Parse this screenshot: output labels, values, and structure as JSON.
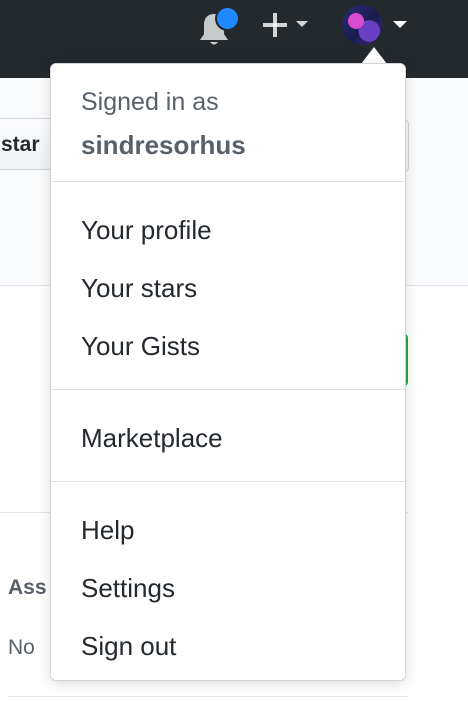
{
  "header": {
    "notifications": {
      "icon": "bell-icon",
      "has_unread": true,
      "indicator_color": "#2188ff"
    },
    "create_menu": {
      "icon": "plus-icon"
    },
    "user_menu": {
      "icon": "avatar"
    }
  },
  "background_page": {
    "star_button_label": "star",
    "assignees_label": "Ass",
    "assignees_value": "No"
  },
  "dropdown": {
    "signed_in_label": "Signed in as",
    "username": "sindresorhus",
    "sections": [
      {
        "items": [
          {
            "label": "Your profile"
          },
          {
            "label": "Your stars"
          },
          {
            "label": "Your Gists"
          }
        ]
      },
      {
        "items": [
          {
            "label": "Marketplace"
          }
        ]
      },
      {
        "items": [
          {
            "label": "Help"
          },
          {
            "label": "Settings"
          },
          {
            "label": "Sign out"
          }
        ]
      }
    ]
  },
  "colors": {
    "header_bg": "#24292e",
    "text_primary": "#24292e",
    "text_muted": "#586069",
    "border": "#e1e4e8",
    "success_green": "#28a745"
  }
}
